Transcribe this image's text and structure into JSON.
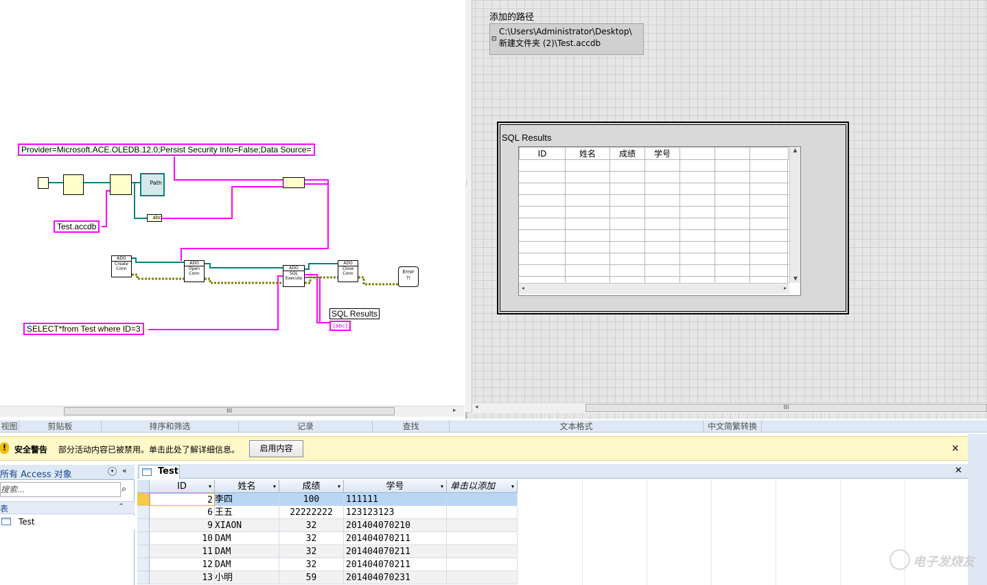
{
  "block_diagram": {
    "connection_string": "Provider=Microsoft.ACE.OLEDB.12.0;Persist Security Info=False;Data Source=",
    "file_name": "Test.accdb",
    "sql_query": "SELECT*from Test where ID=3",
    "sql_results_label": "SQL Results",
    "path_node": "Path",
    "vi_create_conn": {
      "hdr": "ADO",
      "lines": [
        "Create",
        "Conn"
      ]
    },
    "vi_open_conn": {
      "hdr": "ADO",
      "lines": [
        "Open",
        "Conn"
      ]
    },
    "vi_sql_execute": {
      "hdr": "ADO",
      "lines": [
        "SQL",
        "Execute"
      ]
    },
    "vi_close_conn": {
      "hdr": "ADO",
      "lines": [
        "Close",
        "Conn"
      ]
    },
    "error_node": "Error",
    "error_node_2": "?!",
    "abc_indicator": "[abc]",
    "abc_node": "abc",
    "scroll_grip": "III"
  },
  "front_panel": {
    "path_label": "添加的路径",
    "path_value": "C:\\Users\\Administrator\\Desktop\\\n新建文件夹 (2)\\Test.accdb",
    "sql_results_title": "SQL Results",
    "sql_columns": [
      "ID",
      "姓名",
      "成绩",
      "学号",
      "",
      "",
      "",
      ""
    ],
    "scroll_grip": "III"
  },
  "access": {
    "ribbon_groups": [
      "视图",
      "剪贴板",
      "排序和筛选",
      "记录",
      "查找",
      "文本格式",
      "中文简繁转换"
    ],
    "security_warning": {
      "title": "安全警告",
      "message": "部分活动内容已被禁用。单击此处了解详细信息。",
      "button": "启用内容",
      "close": "×"
    },
    "nav": {
      "header": "所有 Access 对象",
      "search_placeholder": "搜索...",
      "group": "表",
      "items": [
        "Test"
      ]
    },
    "datasheet": {
      "tab": "Test",
      "columns": [
        "ID",
        "姓名",
        "成绩",
        "学号",
        "单击以添加"
      ],
      "rows": [
        {
          "id": "2",
          "name": "李四",
          "score": "100",
          "sno": "111111"
        },
        {
          "id": "6",
          "name": "王五",
          "score": "22222222",
          "sno": "123123123"
        },
        {
          "id": "9",
          "name": "XIAON",
          "score": "32",
          "sno": "201404070210"
        },
        {
          "id": "10",
          "name": "DAM",
          "score": "32",
          "sno": "201404070211"
        },
        {
          "id": "11",
          "name": "DAM",
          "score": "32",
          "sno": "201404070211"
        },
        {
          "id": "12",
          "name": "DAM",
          "score": "32",
          "sno": "201404070211"
        },
        {
          "id": "13",
          "name": "小明",
          "score": "59",
          "sno": "201404070231"
        }
      ]
    }
  },
  "watermark": "电子发烧友"
}
